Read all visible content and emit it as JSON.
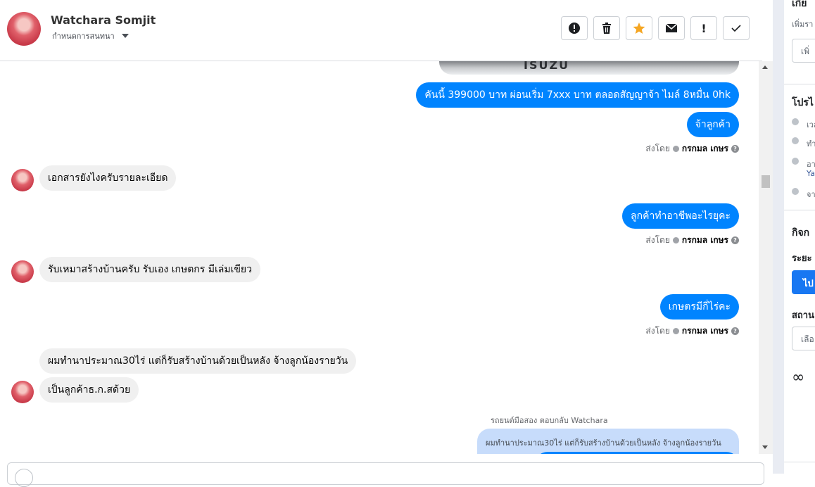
{
  "header": {
    "name": "Watchara Somjit",
    "assign_label": "กำหนดการสนทนา"
  },
  "toolbar": [
    "!",
    "🗑",
    "★",
    "✉",
    "!",
    "✓"
  ],
  "messages": {
    "out1": "คันนี้ 399000 บาท ผ่อนเริ่ม 7xxx บาท ตลอดสัญญาจ้า ไมล์ 8หมื่น 0hk",
    "out2": "จ้าลูกค้า",
    "in1": "เอกสารยังไงครับรายละเอียด",
    "out3": "ลูกค้าทำอาชีพอะไรยุคะ",
    "in2": "รับเหมาสร้างบ้านครับ  รับเอง  เกษตกร มีเล่มเขียว",
    "out4": "เกษตรมีกี่ไร่คะ",
    "in3": "ผมทำนาประมาณ30ไร่  แต่ก็รับสร้างบ้านด้วยเป็นหลัง  จ้างลูกน้องรายวัน",
    "in4": "เป็นลูกค้าธ.ก.สด้วย",
    "reply_label": "รถยนต์มือสอง ตอบกลับ Watchara",
    "reply_quote": "ผมทำนาประมาณ30ไร่ แต่ก็รับสร้างบ้านด้วยเป็นหลัง จ้างลูกน้องรายวัน",
    "image_text": "ISUZU"
  },
  "sent_by": {
    "prefix": "ส่งโดย",
    "name": "กรกมล เกษร"
  },
  "right_panel": {
    "top_title": "เกี่ย",
    "add_hint": "เพิ่มรา",
    "add_input": "เพิ่",
    "profile_title": "โปรไ",
    "row1": "เวล",
    "row2": "ทำ",
    "row3": "อา",
    "row3b": "Ya",
    "row4": "จา",
    "activity_title": "กิจก",
    "period_label": "ระยะ",
    "go_button": "ไป",
    "status_label": "สถาน",
    "select_placeholder": "เลือ",
    "meta_icon": "∞"
  },
  "colors": {
    "accent": "#0084ff",
    "incoming": "#f0f0f0",
    "star": "#f5a623"
  }
}
